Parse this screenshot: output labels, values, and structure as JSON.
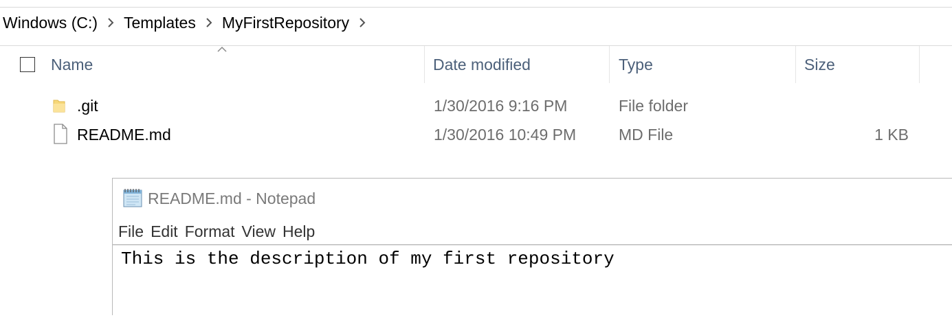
{
  "explorer": {
    "breadcrumb": [
      "Windows (C:)",
      "Templates",
      "MyFirstRepository"
    ],
    "columns": {
      "name": "Name",
      "date_modified": "Date modified",
      "type": "Type",
      "size": "Size"
    },
    "sort_column": "Name",
    "sort_direction": "ascending",
    "files": [
      {
        "name": ".git",
        "date_modified": "1/30/2016 9:16 PM",
        "type": "File folder",
        "size": "",
        "icon": "folder-icon"
      },
      {
        "name": "README.md",
        "date_modified": "1/30/2016 10:49 PM",
        "type": "MD File",
        "size": "1 KB",
        "icon": "file-icon"
      }
    ]
  },
  "notepad": {
    "title": "README.md - Notepad",
    "menu": [
      "File",
      "Edit",
      "Format",
      "View",
      "Help"
    ],
    "content": "This is the description of my first repository"
  },
  "colors": {
    "header_text": "#4c607a",
    "folder_yellow": "#f6d77a",
    "secondary_text": "#6d6d6d"
  }
}
